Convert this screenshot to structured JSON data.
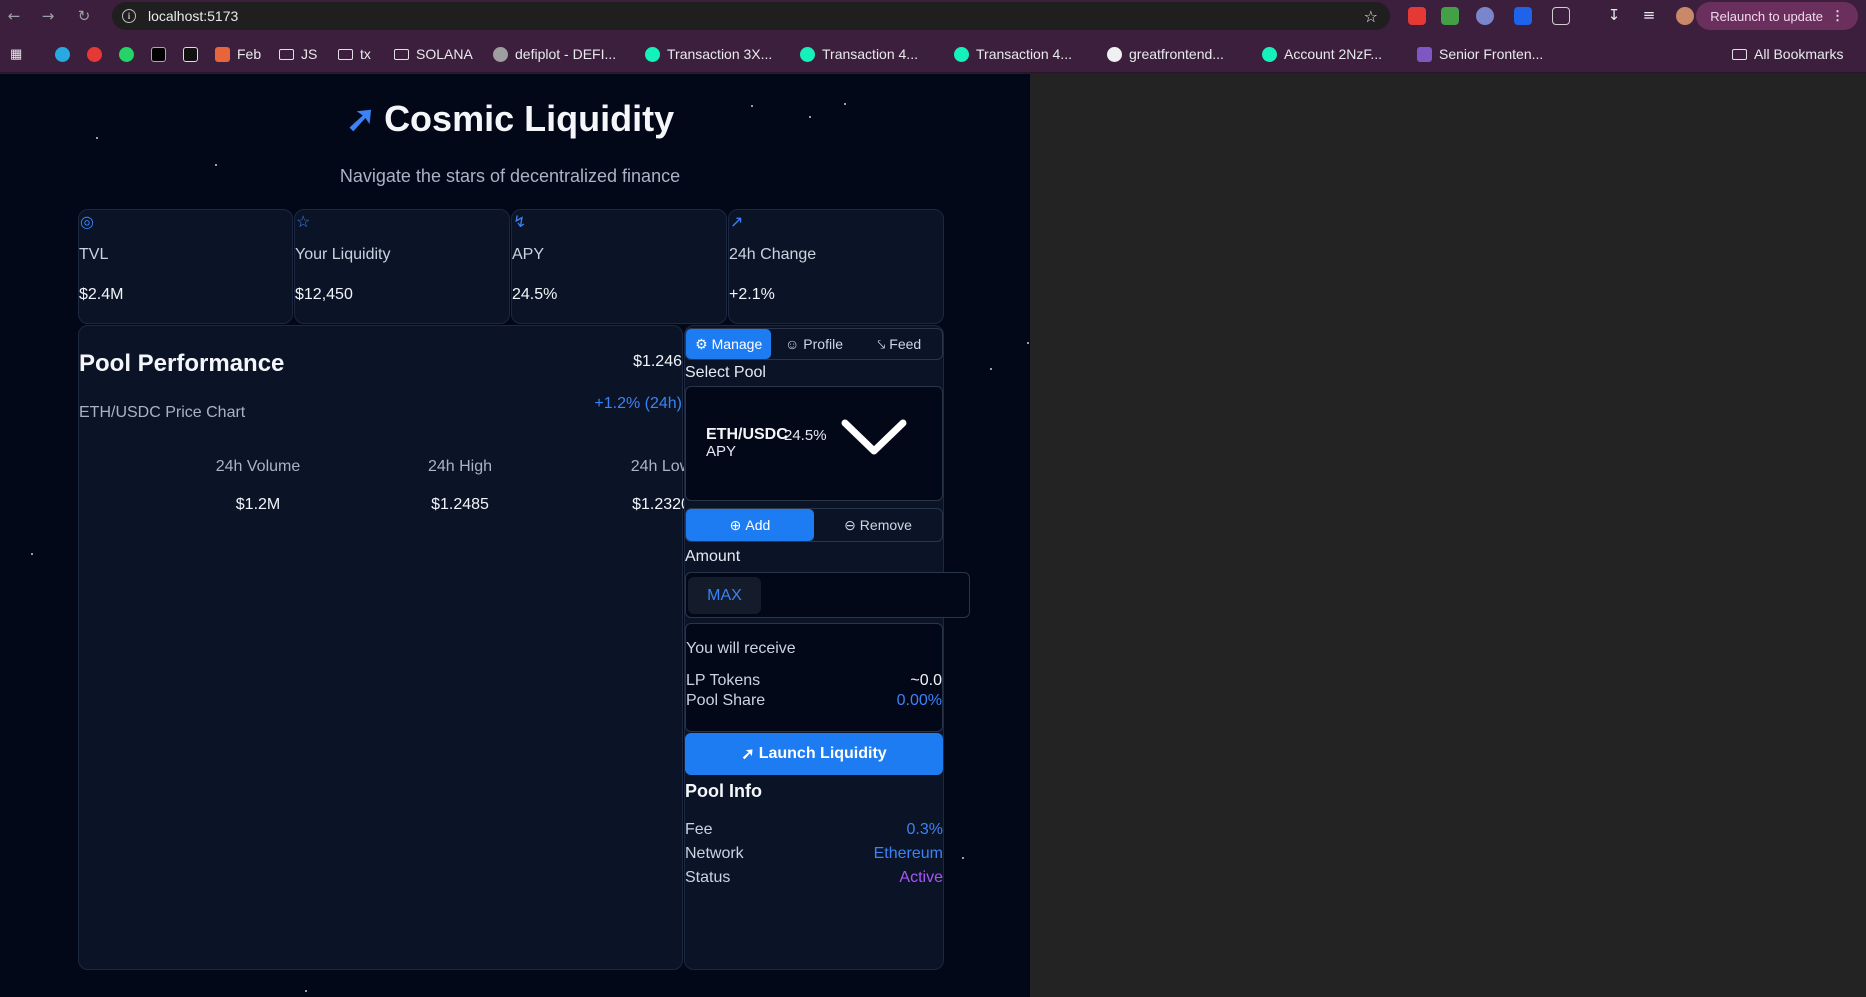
{
  "browser": {
    "url": "localhost:5173",
    "relaunch_label": "Relaunch to update",
    "bookmarks": [
      {
        "label": "Feb",
        "icon": "html-icon"
      },
      {
        "label": "JS",
        "icon": "folder-icon"
      },
      {
        "label": "tx",
        "icon": "folder-icon"
      },
      {
        "label": "SOLANA",
        "icon": "folder-icon"
      },
      {
        "label": "defiplot - DEFI...",
        "icon": "site-icon"
      },
      {
        "label": "Transaction 3X...",
        "icon": "explorer-icon"
      },
      {
        "label": "Transaction 4...",
        "icon": "explorer-icon"
      },
      {
        "label": "Transaction 4...",
        "icon": "explorer-icon"
      },
      {
        "label": "greatfrontend...",
        "icon": "github-icon"
      },
      {
        "label": "Account 2NzF...",
        "icon": "explorer-icon"
      },
      {
        "label": "Senior Fronten...",
        "icon": "list-icon"
      },
      {
        "label": "All Bookmarks",
        "icon": "folder-icon"
      }
    ]
  },
  "hero": {
    "title": "Cosmic Liquidity",
    "subtitle": "Navigate the stars of decentralized finance"
  },
  "stats": [
    {
      "label": "TVL",
      "value": "$2.4M",
      "icon": "globe-icon"
    },
    {
      "label": "Your Liquidity",
      "value": "$12,450",
      "icon": "star-icon"
    },
    {
      "label": "APY",
      "value": "24.5%",
      "icon": "bolt-icon"
    },
    {
      "label": "24h Change",
      "value": "+2.1%",
      "icon": "trending-up-icon"
    }
  ],
  "performance": {
    "title": "Pool Performance",
    "subtitle": "ETH/USDC Price Chart",
    "price": "$1.246",
    "change": "+1.2% (24h)",
    "metrics": [
      {
        "label": "24h Volume",
        "value": "$1.2M"
      },
      {
        "label": "24h High",
        "value": "$1.2485"
      },
      {
        "label": "24h Low",
        "value": "$1.2320"
      }
    ]
  },
  "manage": {
    "tabs": [
      {
        "label": "Manage",
        "active": true
      },
      {
        "label": "Profile",
        "active": false
      },
      {
        "label": "Feed",
        "active": false
      }
    ],
    "select_label": "Select Pool",
    "selected_pool": {
      "pair": "ETH/USDC",
      "apy": "24.5%",
      "apy_suffix": "APY"
    },
    "actions": [
      {
        "label": "Add",
        "active": true
      },
      {
        "label": "Remove",
        "active": false
      }
    ],
    "amount_label": "Amount",
    "amount_value": "",
    "max_label": "MAX",
    "receive": {
      "title": "You will receive",
      "rows": [
        {
          "label": "LP Tokens",
          "value": "~0.0",
          "color": "#f1f4f9"
        },
        {
          "label": "Pool Share",
          "value": "0.00%",
          "color": "#3b82f6"
        }
      ]
    },
    "launch_label": "Launch Liquidity",
    "info": {
      "title": "Pool Info",
      "rows": [
        {
          "label": "Fee",
          "value": "0.3%",
          "color": "#3b82f6"
        },
        {
          "label": "Network",
          "value": "Ethereum",
          "color": "#3b82f6"
        },
        {
          "label": "Status",
          "value": "Active",
          "color": "#a855f7"
        }
      ]
    }
  },
  "colors": {
    "accent": "#1d7cf2",
    "background": "#030818",
    "card": "#0b1426",
    "status_active": "#a855f7"
  }
}
